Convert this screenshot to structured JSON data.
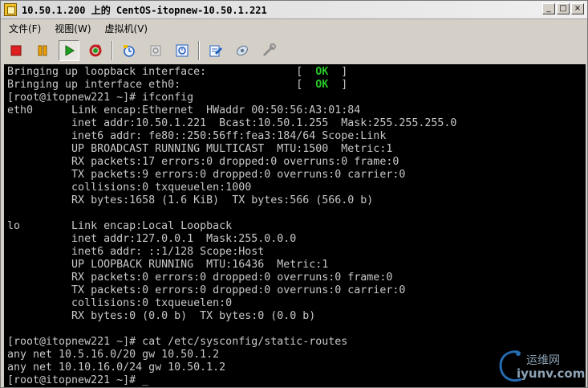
{
  "window": {
    "title": "10.50.1.200 上的 CentOS-itopnew-10.50.1.221",
    "controls": {
      "minimize": "_",
      "maximize": "□",
      "close": "×"
    }
  },
  "menu": {
    "items": [
      {
        "label": "文件(F)"
      },
      {
        "label": "视图(W)"
      },
      {
        "label": "虚拟机(V)"
      }
    ]
  },
  "toolbar": {
    "buttons": [
      {
        "icon": "stop-icon",
        "color": "#e02020"
      },
      {
        "icon": "pause-icon",
        "color": "#f0a000"
      },
      {
        "icon": "play-icon",
        "color": "#20a020"
      },
      {
        "icon": "reset-icon",
        "color": "#c02020"
      },
      {
        "icon": "snapshot-icon",
        "color": "#2060c0"
      },
      {
        "icon": "revert-snapshot-icon",
        "color": "#909090"
      },
      {
        "icon": "manage-snapshots-icon",
        "color": "#2060c0"
      },
      {
        "icon": "edit-settings-icon",
        "color": "#2060c0"
      },
      {
        "icon": "connect-device-icon",
        "color": "#8090a0"
      },
      {
        "icon": "tools-icon",
        "color": "#909090"
      }
    ]
  },
  "console": {
    "status_lines": [
      {
        "text": "Bringing up loopback interface:",
        "status": "OK"
      },
      {
        "text": "Bringing up interface eth0:",
        "status": "OK"
      }
    ],
    "lines": [
      "[root@itopnew221 ~]# ifconfig",
      "eth0      Link encap:Ethernet  HWaddr 00:50:56:A3:01:84",
      "          inet addr:10.50.1.221  Bcast:10.50.1.255  Mask:255.255.255.0",
      "          inet6 addr: fe80::250:56ff:fea3:184/64 Scope:Link",
      "          UP BROADCAST RUNNING MULTICAST  MTU:1500  Metric:1",
      "          RX packets:17 errors:0 dropped:0 overruns:0 frame:0",
      "          TX packets:9 errors:0 dropped:0 overruns:0 carrier:0",
      "          collisions:0 txqueuelen:1000",
      "          RX bytes:1658 (1.6 KiB)  TX bytes:566 (566.0 b)",
      "",
      "lo        Link encap:Local Loopback",
      "          inet addr:127.0.0.1  Mask:255.0.0.0",
      "          inet6 addr: ::1/128 Scope:Host",
      "          UP LOOPBACK RUNNING  MTU:16436  Metric:1",
      "          RX packets:0 errors:0 dropped:0 overruns:0 frame:0",
      "          TX packets:0 errors:0 dropped:0 overruns:0 carrier:0",
      "          collisions:0 txqueuelen:0",
      "          RX bytes:0 (0.0 b)  TX bytes:0 (0.0 b)",
      "",
      "[root@itopnew221 ~]# cat /etc/sysconfig/static-routes",
      "any net 10.5.16.0/20 gw 10.50.1.2",
      "any net 10.10.16.0/24 gw 10.50.1.2"
    ],
    "prompt": "[root@itopnew221 ~]# ",
    "cursor": "_"
  },
  "watermark": {
    "line1": "运维网",
    "line2": "iyunv.com"
  }
}
